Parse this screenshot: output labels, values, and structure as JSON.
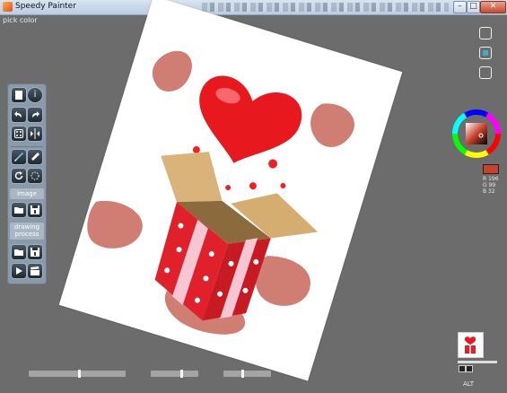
{
  "window": {
    "title": "Speedy Painter",
    "minimize_glyph": "–",
    "maximize_glyph": "□",
    "close_glyph": "✕"
  },
  "status_text": "pick color",
  "toolbar": {
    "tools": [
      {
        "name": "new-page-icon"
      },
      {
        "name": "info-icon",
        "glyph": "i"
      },
      {
        "name": "undo-icon"
      },
      {
        "name": "redo-icon"
      },
      {
        "name": "dice-icon"
      },
      {
        "name": "mirror-icon"
      },
      {
        "name": "brush-icon"
      },
      {
        "name": "eraser-icon"
      },
      {
        "name": "rotate-icon"
      },
      {
        "name": "selection-icon"
      }
    ],
    "image_section_label": "image",
    "drawing_section_label_line1": "drawing",
    "drawing_section_label_line2": "process",
    "image_tools": [
      {
        "name": "open-folder-icon"
      },
      {
        "name": "save-icon"
      }
    ],
    "process_tools": [
      {
        "name": "open-folder-icon"
      },
      {
        "name": "save-icon"
      },
      {
        "name": "play-icon"
      },
      {
        "name": "clapperboard-icon"
      }
    ]
  },
  "color_panel": {
    "current_color": "#c9412c",
    "r_text": "R 196",
    "g_text": "G 99",
    "b_text": "B 32"
  },
  "navigator": {
    "label": "ALT"
  },
  "sliders": {
    "brush_size": 0.52,
    "opacity": 0.65,
    "softness": 0.4
  },
  "colors": {
    "background": "#6c6c6c",
    "toolbar": "#8b9aa9",
    "paint_stroke": "#c8665a",
    "gift_red": "#e0202a"
  }
}
